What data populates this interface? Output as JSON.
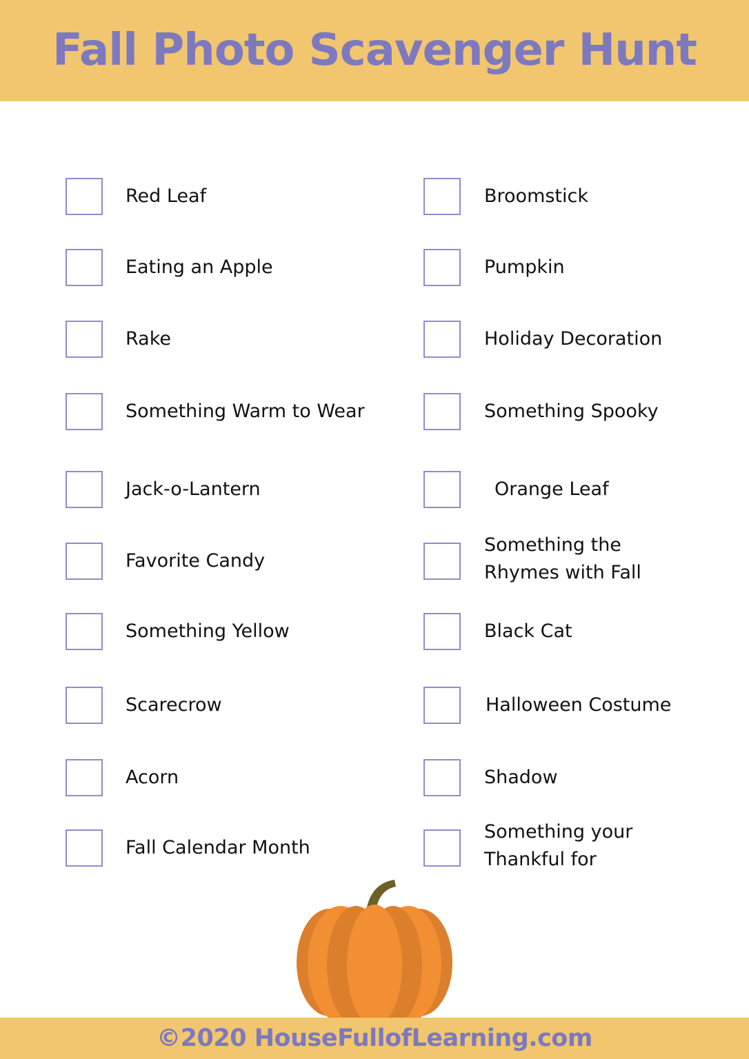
{
  "header": {
    "title": "Fall Photo Scavenger Hunt"
  },
  "colors": {
    "banner": "#f2c66e",
    "title_text": "#7d79bf",
    "checkbox_border": "#8f8ccf",
    "pumpkin_light": "#f28f32",
    "pumpkin_dark": "#db7f2c",
    "stem": "#6b6028"
  },
  "items": {
    "left": [
      {
        "label": "Red Leaf",
        "checked": false
      },
      {
        "label": "Eating an Apple",
        "checked": false
      },
      {
        "label": "Rake",
        "checked": false
      },
      {
        "label": "Something Warm to Wear",
        "checked": false
      },
      {
        "label": "Jack-o-Lantern",
        "checked": false
      },
      {
        "label": "Favorite Candy",
        "checked": false
      },
      {
        "label": "Something Yellow",
        "checked": false
      },
      {
        "label": "Scarecrow",
        "checked": false
      },
      {
        "label": "Acorn",
        "checked": false
      },
      {
        "label": "Fall Calendar Month",
        "checked": false
      }
    ],
    "right": [
      {
        "label": "Broomstick",
        "checked": false
      },
      {
        "label": "Pumpkin",
        "checked": false
      },
      {
        "label": "Holiday Decoration",
        "checked": false
      },
      {
        "label": "Something Spooky",
        "checked": false
      },
      {
        "label": "Orange Leaf",
        "checked": false
      },
      {
        "label": "Something the",
        "label_line2": "Rhymes with Fall",
        "checked": false
      },
      {
        "label": "Black Cat",
        "checked": false
      },
      {
        "label": "Halloween Costume",
        "checked": false
      },
      {
        "label": "Shadow",
        "checked": false
      },
      {
        "label": "Something your",
        "label_line2": "Thankful for",
        "checked": false
      }
    ]
  },
  "decoration": {
    "icon": "pumpkin-icon"
  },
  "footer": {
    "text": "©2020 HouseFullofLearning.com"
  }
}
